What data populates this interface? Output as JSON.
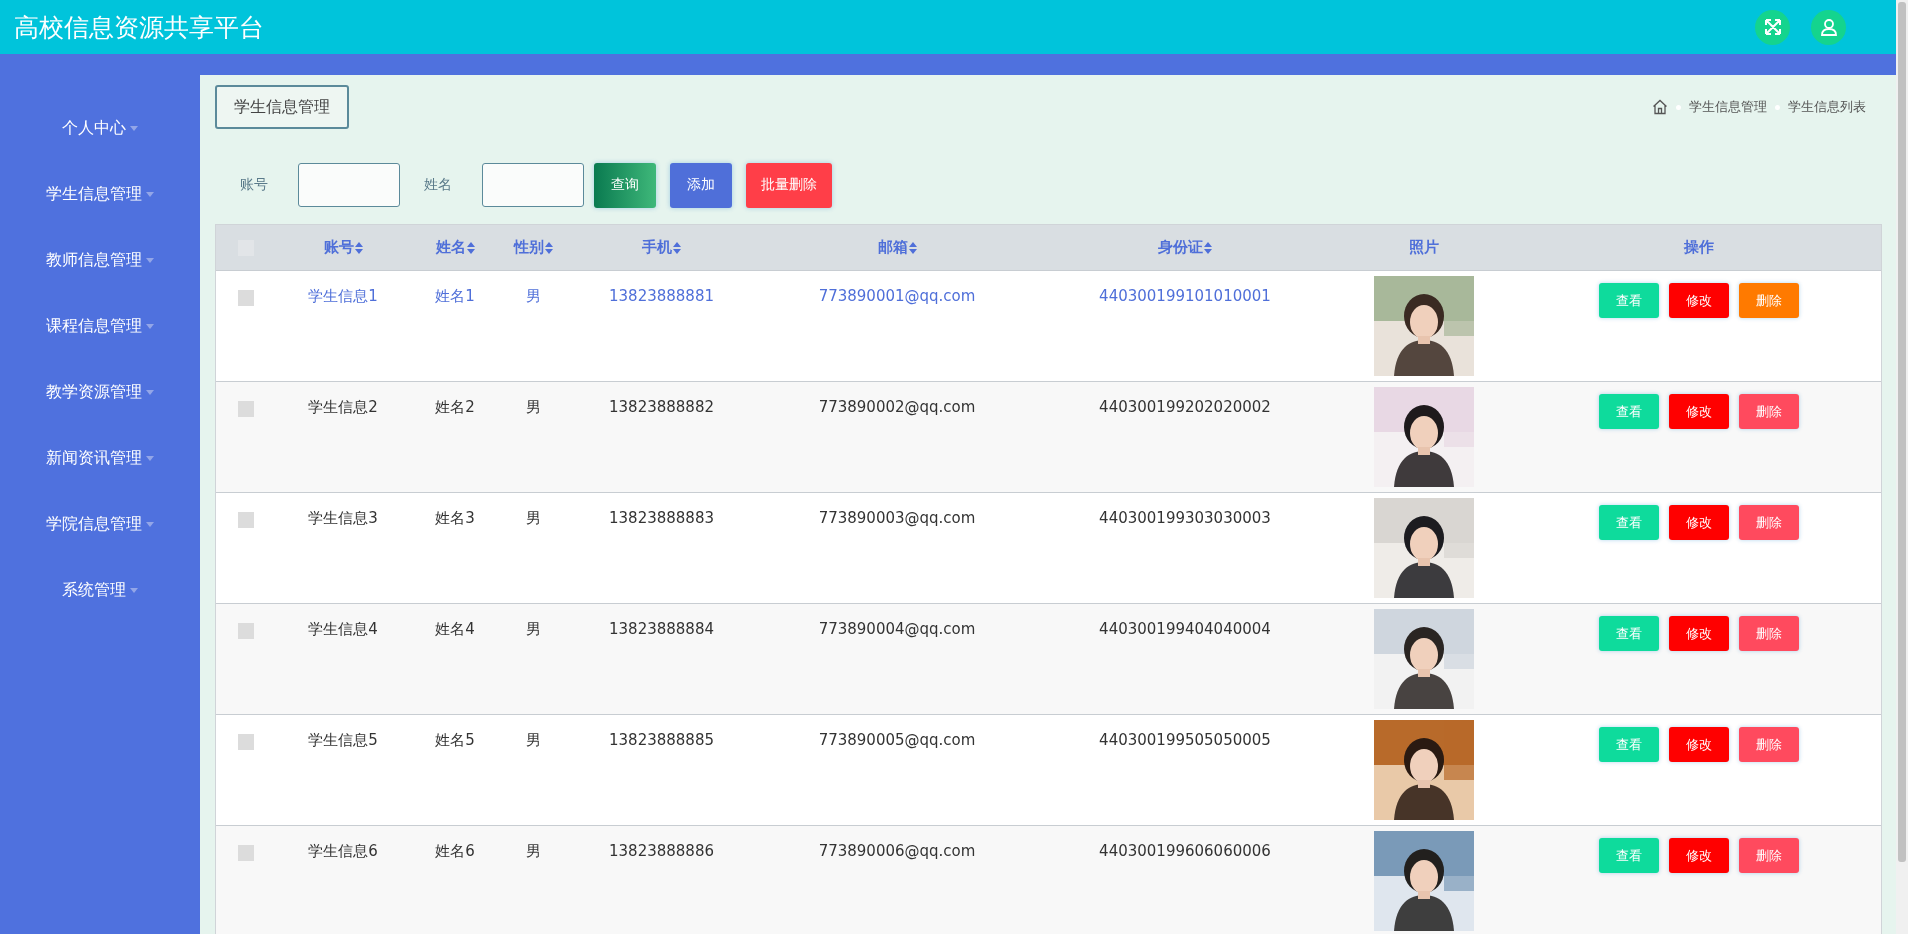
{
  "header": {
    "title": "高校信息资源共享平台"
  },
  "sidebar": {
    "items": [
      {
        "label": "个人中心"
      },
      {
        "label": "学生信息管理"
      },
      {
        "label": "教师信息管理"
      },
      {
        "label": "课程信息管理"
      },
      {
        "label": "教学资源管理"
      },
      {
        "label": "新闻资讯管理"
      },
      {
        "label": "学院信息管理"
      },
      {
        "label": "系统管理"
      }
    ]
  },
  "page_tab": "学生信息管理",
  "breadcrumb": [
    "学生信息管理",
    "学生信息列表"
  ],
  "search": {
    "fields": [
      {
        "label": "账号"
      },
      {
        "label": "姓名"
      }
    ],
    "buttons": [
      {
        "kind": "query",
        "label": "查询"
      },
      {
        "kind": "add",
        "label": "添加"
      },
      {
        "kind": "batch-delete",
        "label": "批量删除"
      }
    ]
  },
  "table": {
    "select_all_checked": false,
    "columns": [
      {
        "label": "账号",
        "sortable": true
      },
      {
        "label": "姓名",
        "sortable": true
      },
      {
        "label": "性别",
        "sortable": true
      },
      {
        "label": "手机",
        "sortable": true
      },
      {
        "label": "邮箱",
        "sortable": true
      },
      {
        "label": "身份证",
        "sortable": true
      },
      {
        "label": "照片",
        "sortable": false
      },
      {
        "label": "操作",
        "sortable": false
      }
    ],
    "rows": [
      {
        "hovered": true,
        "checked": false,
        "cells": [
          "学生信息1",
          "姓名1",
          "男",
          "13823888881",
          "773890001@qq.com",
          "440300199101010001"
        ],
        "actions": [
          "查看",
          "修改",
          "删除"
        ]
      },
      {
        "hovered": false,
        "checked": false,
        "cells": [
          "学生信息2",
          "姓名2",
          "男",
          "13823888882",
          "773890002@qq.com",
          "440300199202020002"
        ],
        "actions": [
          "查看",
          "修改",
          "删除"
        ]
      },
      {
        "hovered": false,
        "checked": false,
        "cells": [
          "学生信息3",
          "姓名3",
          "男",
          "13823888883",
          "773890003@qq.com",
          "440300199303030003"
        ],
        "actions": [
          "查看",
          "修改",
          "删除"
        ]
      },
      {
        "hovered": false,
        "checked": false,
        "cells": [
          "学生信息4",
          "姓名4",
          "男",
          "13823888884",
          "773890004@qq.com",
          "440300199404040004"
        ],
        "actions": [
          "查看",
          "修改",
          "删除"
        ]
      },
      {
        "hovered": false,
        "checked": false,
        "cells": [
          "学生信息5",
          "姓名5",
          "男",
          "13823888885",
          "773890005@qq.com",
          "440300199505050005"
        ],
        "actions": [
          "查看",
          "修改",
          "删除"
        ]
      },
      {
        "hovered": false,
        "checked": false,
        "cells": [
          "学生信息6",
          "姓名6",
          "男",
          "13823888886",
          "773890006@qq.com",
          "440300199606060006"
        ],
        "actions": [
          "查看",
          "修改",
          "删除"
        ]
      }
    ]
  }
}
